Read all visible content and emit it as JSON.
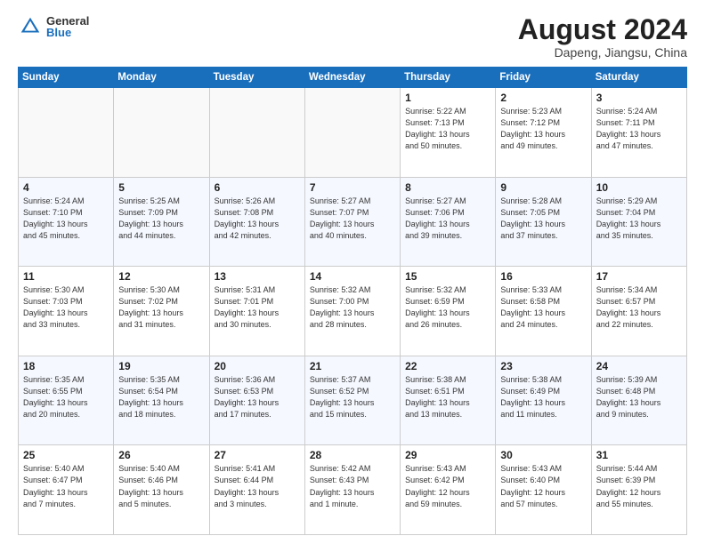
{
  "header": {
    "logo_general": "General",
    "logo_blue": "Blue",
    "title": "August 2024",
    "location": "Dapeng, Jiangsu, China"
  },
  "days_of_week": [
    "Sunday",
    "Monday",
    "Tuesday",
    "Wednesday",
    "Thursday",
    "Friday",
    "Saturday"
  ],
  "weeks": [
    [
      {
        "day": "",
        "info": ""
      },
      {
        "day": "",
        "info": ""
      },
      {
        "day": "",
        "info": ""
      },
      {
        "day": "",
        "info": ""
      },
      {
        "day": "1",
        "info": "Sunrise: 5:22 AM\nSunset: 7:13 PM\nDaylight: 13 hours\nand 50 minutes."
      },
      {
        "day": "2",
        "info": "Sunrise: 5:23 AM\nSunset: 7:12 PM\nDaylight: 13 hours\nand 49 minutes."
      },
      {
        "day": "3",
        "info": "Sunrise: 5:24 AM\nSunset: 7:11 PM\nDaylight: 13 hours\nand 47 minutes."
      }
    ],
    [
      {
        "day": "4",
        "info": "Sunrise: 5:24 AM\nSunset: 7:10 PM\nDaylight: 13 hours\nand 45 minutes."
      },
      {
        "day": "5",
        "info": "Sunrise: 5:25 AM\nSunset: 7:09 PM\nDaylight: 13 hours\nand 44 minutes."
      },
      {
        "day": "6",
        "info": "Sunrise: 5:26 AM\nSunset: 7:08 PM\nDaylight: 13 hours\nand 42 minutes."
      },
      {
        "day": "7",
        "info": "Sunrise: 5:27 AM\nSunset: 7:07 PM\nDaylight: 13 hours\nand 40 minutes."
      },
      {
        "day": "8",
        "info": "Sunrise: 5:27 AM\nSunset: 7:06 PM\nDaylight: 13 hours\nand 39 minutes."
      },
      {
        "day": "9",
        "info": "Sunrise: 5:28 AM\nSunset: 7:05 PM\nDaylight: 13 hours\nand 37 minutes."
      },
      {
        "day": "10",
        "info": "Sunrise: 5:29 AM\nSunset: 7:04 PM\nDaylight: 13 hours\nand 35 minutes."
      }
    ],
    [
      {
        "day": "11",
        "info": "Sunrise: 5:30 AM\nSunset: 7:03 PM\nDaylight: 13 hours\nand 33 minutes."
      },
      {
        "day": "12",
        "info": "Sunrise: 5:30 AM\nSunset: 7:02 PM\nDaylight: 13 hours\nand 31 minutes."
      },
      {
        "day": "13",
        "info": "Sunrise: 5:31 AM\nSunset: 7:01 PM\nDaylight: 13 hours\nand 30 minutes."
      },
      {
        "day": "14",
        "info": "Sunrise: 5:32 AM\nSunset: 7:00 PM\nDaylight: 13 hours\nand 28 minutes."
      },
      {
        "day": "15",
        "info": "Sunrise: 5:32 AM\nSunset: 6:59 PM\nDaylight: 13 hours\nand 26 minutes."
      },
      {
        "day": "16",
        "info": "Sunrise: 5:33 AM\nSunset: 6:58 PM\nDaylight: 13 hours\nand 24 minutes."
      },
      {
        "day": "17",
        "info": "Sunrise: 5:34 AM\nSunset: 6:57 PM\nDaylight: 13 hours\nand 22 minutes."
      }
    ],
    [
      {
        "day": "18",
        "info": "Sunrise: 5:35 AM\nSunset: 6:55 PM\nDaylight: 13 hours\nand 20 minutes."
      },
      {
        "day": "19",
        "info": "Sunrise: 5:35 AM\nSunset: 6:54 PM\nDaylight: 13 hours\nand 18 minutes."
      },
      {
        "day": "20",
        "info": "Sunrise: 5:36 AM\nSunset: 6:53 PM\nDaylight: 13 hours\nand 17 minutes."
      },
      {
        "day": "21",
        "info": "Sunrise: 5:37 AM\nSunset: 6:52 PM\nDaylight: 13 hours\nand 15 minutes."
      },
      {
        "day": "22",
        "info": "Sunrise: 5:38 AM\nSunset: 6:51 PM\nDaylight: 13 hours\nand 13 minutes."
      },
      {
        "day": "23",
        "info": "Sunrise: 5:38 AM\nSunset: 6:49 PM\nDaylight: 13 hours\nand 11 minutes."
      },
      {
        "day": "24",
        "info": "Sunrise: 5:39 AM\nSunset: 6:48 PM\nDaylight: 13 hours\nand 9 minutes."
      }
    ],
    [
      {
        "day": "25",
        "info": "Sunrise: 5:40 AM\nSunset: 6:47 PM\nDaylight: 13 hours\nand 7 minutes."
      },
      {
        "day": "26",
        "info": "Sunrise: 5:40 AM\nSunset: 6:46 PM\nDaylight: 13 hours\nand 5 minutes."
      },
      {
        "day": "27",
        "info": "Sunrise: 5:41 AM\nSunset: 6:44 PM\nDaylight: 13 hours\nand 3 minutes."
      },
      {
        "day": "28",
        "info": "Sunrise: 5:42 AM\nSunset: 6:43 PM\nDaylight: 13 hours\nand 1 minute."
      },
      {
        "day": "29",
        "info": "Sunrise: 5:43 AM\nSunset: 6:42 PM\nDaylight: 12 hours\nand 59 minutes."
      },
      {
        "day": "30",
        "info": "Sunrise: 5:43 AM\nSunset: 6:40 PM\nDaylight: 12 hours\nand 57 minutes."
      },
      {
        "day": "31",
        "info": "Sunrise: 5:44 AM\nSunset: 6:39 PM\nDaylight: 12 hours\nand 55 minutes."
      }
    ]
  ]
}
